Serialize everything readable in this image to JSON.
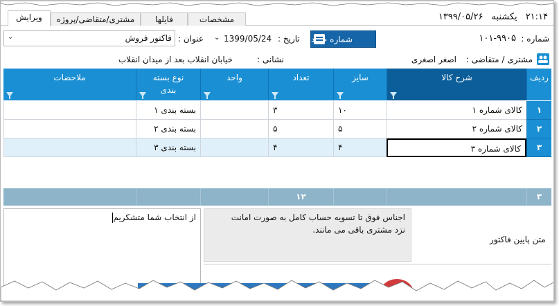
{
  "window": {
    "clock": "۲۱:۱۴",
    "day_name": "یکشنبه",
    "date_header": "۱۳۹۹/۰۵/۲۶"
  },
  "tabs": [
    {
      "label": "ویرایش",
      "active": true
    },
    {
      "label": "مشتری/متقاضی/پروژه",
      "active": false
    },
    {
      "label": "فایلها",
      "active": false
    },
    {
      "label": "مشخصات",
      "active": false
    }
  ],
  "header": {
    "number_label": "شماره :",
    "number_value": "۱۰۱-۹۹۰۵",
    "new_number_button": "شماره جدید",
    "date_label": "تاریخ :",
    "date_value": "1399/05/24",
    "title_label": "عنوان :",
    "title_value": "فاکتور فروش",
    "customer_label": "مشتری / متقاضی :",
    "customer_value": "اصغر اصغری",
    "address_label": "نشانی :",
    "address_value": "خیابان انقلاب بعد از میدان انقلاب"
  },
  "grid": {
    "columns": [
      "ردیف",
      "شرح کالا",
      "سایز",
      "تعداد",
      "واحد",
      "نوع بسته بندی",
      "ملاحضات"
    ],
    "rows": [
      {
        "row": "۱",
        "item": "کالای شماره ۱",
        "size": "۱۰",
        "qty": "۳",
        "unit": "",
        "pack": "بسته بندی ۱",
        "notes": ""
      },
      {
        "row": "۲",
        "item": "کالای شماره ۲",
        "size": "۵",
        "qty": "۵",
        "unit": "",
        "pack": "بسته بندی ۲",
        "notes": ""
      },
      {
        "row": "۳",
        "item": "کالای شماره ۳",
        "size": "۴",
        "qty": "۴",
        "unit": "",
        "pack": "بسته بندی ۳",
        "notes": ""
      }
    ],
    "footer": {
      "row_count": "۳",
      "qty_total": "۱۲"
    },
    "colors": {
      "header": "#1a8fd3",
      "selected_row": "#dff0fa",
      "footer": "#8db4c9"
    }
  },
  "bottom": {
    "left_note": "از انتخاب شما متشکریم",
    "right_note_line1": "اجناس فوق تا تسویه حساب کامل به صورت امانت",
    "right_note_line2": "نزد مشتری باقی می مانند.",
    "footer_text_label": "متن پایین فاکتور"
  }
}
